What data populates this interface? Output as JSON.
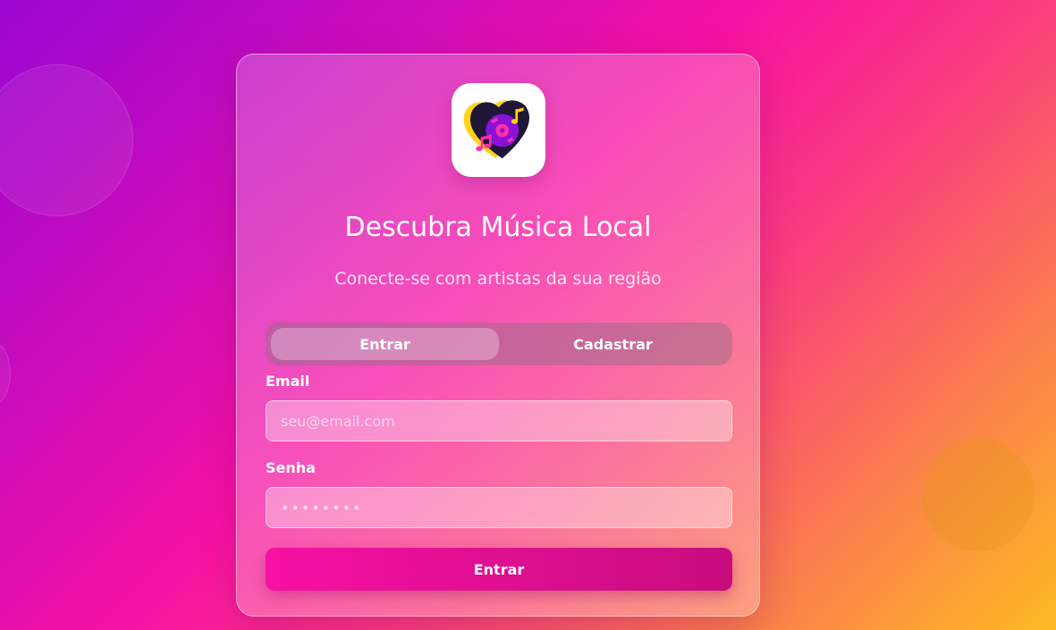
{
  "brand": {
    "logo_icon": "heart-vinyl-music-icon",
    "accent_color": "#f810a4",
    "logo_colors": [
      "#1f1638",
      "#8a12d8",
      "#ff2ea6",
      "#ffd21a"
    ]
  },
  "header": {
    "title": "Descubra Música Local",
    "subtitle": "Conecte-se com artistas da sua região"
  },
  "tabs": [
    {
      "label": "Entrar",
      "active": true
    },
    {
      "label": "Cadastrar",
      "active": false
    }
  ],
  "form": {
    "email_label": "Email",
    "email_placeholder": "seu@email.com",
    "email_value": "",
    "password_label": "Senha",
    "password_placeholder": "••••••••",
    "password_value": "",
    "submit_label": "Entrar"
  }
}
